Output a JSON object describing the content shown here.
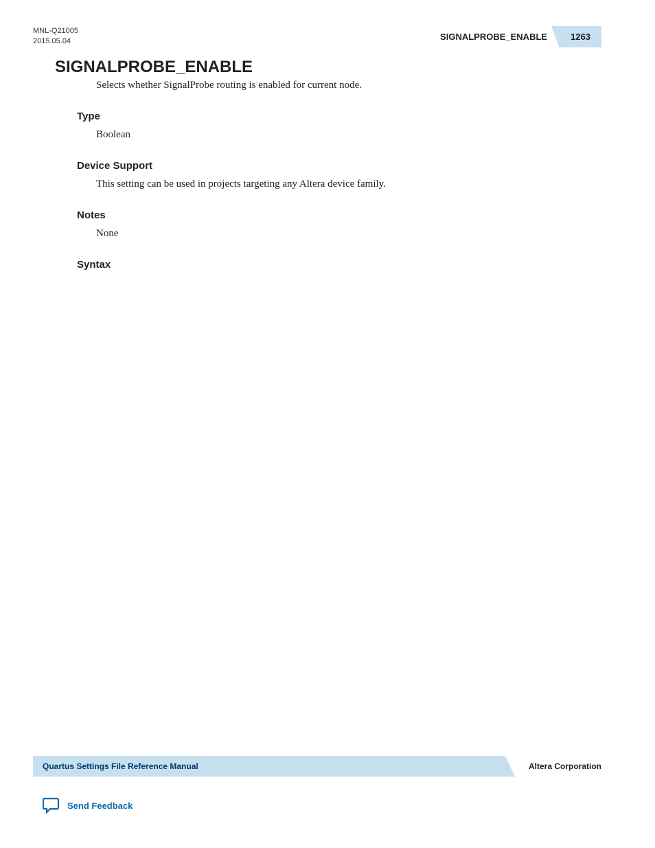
{
  "header": {
    "doc_id": "MNL-Q21005",
    "date": "2015.05.04",
    "title_right": "SIGNALPROBE_ENABLE",
    "page_number": "1263"
  },
  "main": {
    "heading": "SIGNALPROBE_ENABLE",
    "description": "Selects whether SignalProbe routing is enabled for current node.",
    "sections": {
      "type": {
        "label": "Type",
        "value": "Boolean"
      },
      "device_support": {
        "label": "Device Support",
        "value": "This setting can be used in projects targeting any Altera device family."
      },
      "notes": {
        "label": "Notes",
        "value": "None"
      },
      "syntax": {
        "label": "Syntax",
        "value": ""
      }
    }
  },
  "footer": {
    "manual_title": "Quartus Settings File Reference Manual",
    "company": "Altera Corporation",
    "feedback_link": "Send Feedback"
  }
}
